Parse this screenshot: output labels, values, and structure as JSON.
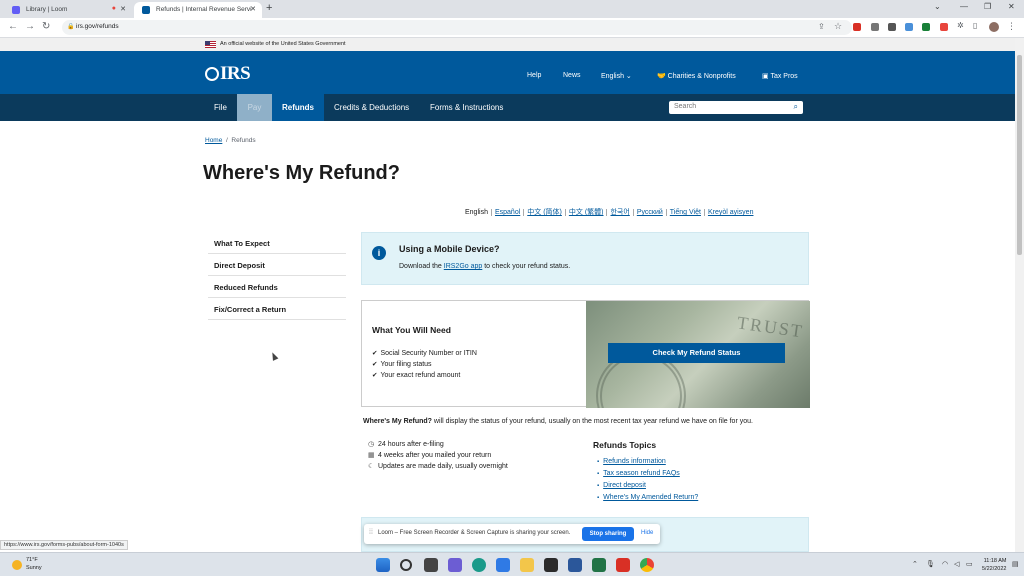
{
  "browser": {
    "tabs": [
      {
        "title": "Library | Loom",
        "active": false
      },
      {
        "title": "Refunds | Internal Revenue Servi",
        "active": true
      }
    ],
    "new_tab": "+",
    "address": "irs.gov/refunds",
    "status_url": "https://www.irs.gov/forms-pubs/about-form-1040s"
  },
  "gov_banner": "An official website of the United States Government",
  "header": {
    "logo": "IRS",
    "links": [
      "Help",
      "News",
      "English",
      "Charities & Nonprofits",
      "Tax Pros"
    ]
  },
  "nav": {
    "items": [
      "File",
      "Pay",
      "Refunds",
      "Credits & Deductions",
      "Forms & Instructions"
    ],
    "search_placeholder": "Search"
  },
  "breadcrumb": {
    "home": "Home",
    "sep": "/",
    "current": "Refunds"
  },
  "page_title": "Where's My Refund?",
  "languages": [
    "English",
    "Español",
    "中文 (简体)",
    "中文 (繁體)",
    "한국어",
    "Русский",
    "Tiếng Việt",
    "Kreyòl ayisyen"
  ],
  "sidenav": [
    "What To Expect",
    "Direct Deposit",
    "Reduced Refunds",
    "Fix/Correct a Return"
  ],
  "mobile_box": {
    "heading": "Using a Mobile Device?",
    "text_before": "Download the ",
    "link": "IRS2Go app",
    "text_after": " to check your refund status."
  },
  "need_box": {
    "heading": "What You Will Need",
    "items": [
      "Social Security Number or ITIN",
      "Your filing status",
      "Your exact refund amount"
    ],
    "image_text": "TRUST",
    "button": "Check My Refund Status"
  },
  "description": {
    "bold": "Where's My Refund?",
    "rest": " will display the status of your refund, usually on the most recent tax year refund we have on file for you."
  },
  "timing": [
    "24 hours after e-filing",
    "4 weeks after you mailed your return",
    "Updates are made daily, usually overnight"
  ],
  "topics": {
    "heading": "Refunds Topics",
    "links": [
      "Refunds information",
      "Tax season refund FAQs",
      "Direct deposit",
      "Where's My Amended Return?"
    ]
  },
  "loom": {
    "message": "Loom – Free Screen Recorder & Screen Capture is sharing your screen.",
    "stop": "Stop sharing",
    "hide": "Hide"
  },
  "taskbar": {
    "temp": "71°F",
    "weather": "Sunny",
    "time": "11:18 AM",
    "date": "5/22/2022"
  },
  "colors": {
    "irs_blue": "#00599c",
    "nav_dark": "#0b3a5c",
    "info_bg": "#e1f3f8"
  }
}
